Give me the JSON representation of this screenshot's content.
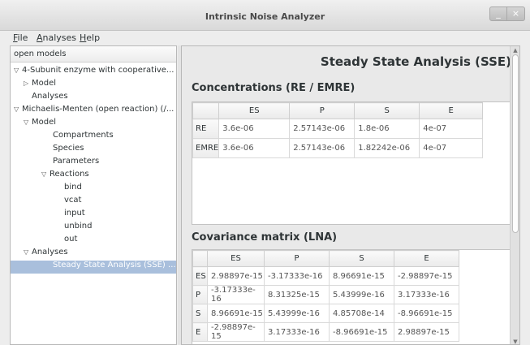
{
  "window": {
    "title": "Intrinsic Noise Analyzer",
    "minimize_glyph": "_",
    "close_glyph": "×"
  },
  "menu": [
    {
      "mnemonic": "F",
      "rest": "ile"
    },
    {
      "mnemonic": "A",
      "rest": "nalyses"
    },
    {
      "mnemonic": "H",
      "rest": "elp"
    }
  ],
  "sidebar": {
    "header": "open models",
    "items": [
      {
        "label": "4-Subunit enzyme with cooperative...",
        "arrow": "▽"
      },
      {
        "label": "Model",
        "arrow": "▷"
      },
      {
        "label": "Analyses",
        "arrow": ""
      },
      {
        "label": "Michaelis-Menten (open reaction) (/...",
        "arrow": "▽"
      },
      {
        "label": "Model",
        "arrow": "▽"
      },
      {
        "label": "Compartments",
        "arrow": ""
      },
      {
        "label": "Species",
        "arrow": ""
      },
      {
        "label": "Parameters",
        "arrow": ""
      },
      {
        "label": "Reactions",
        "arrow": "▽"
      },
      {
        "label": "bind",
        "arrow": ""
      },
      {
        "label": "vcat",
        "arrow": ""
      },
      {
        "label": "input",
        "arrow": ""
      },
      {
        "label": "unbind",
        "arrow": ""
      },
      {
        "label": "out",
        "arrow": ""
      },
      {
        "label": "Analyses",
        "arrow": "▽"
      },
      {
        "label": "Steady State Analysis (SSE) ...",
        "arrow": ""
      }
    ]
  },
  "main": {
    "title": "Steady State Analysis (SSE)",
    "concentrations": {
      "title": "Concentrations (RE / EMRE)",
      "columns": [
        "ES",
        "P",
        "S",
        "E"
      ],
      "rows": [
        {
          "label": "RE",
          "values": [
            "3.6e-06",
            "2.57143e-06",
            "1.8e-06",
            "4e-07"
          ]
        },
        {
          "label": "EMRE",
          "values": [
            "3.6e-06",
            "2.57143e-06",
            "1.82242e-06",
            "4e-07"
          ]
        }
      ]
    },
    "covariance": {
      "title": "Covariance matrix (LNA)",
      "columns": [
        "ES",
        "P",
        "S",
        "E"
      ],
      "rows": [
        {
          "label": "ES",
          "values": [
            "2.98897e-15",
            "-3.17333e-16",
            "8.96691e-15",
            "-2.98897e-15"
          ]
        },
        {
          "label": "P",
          "values": [
            "-3.17333e-16",
            "8.31325e-15",
            "5.43999e-16",
            "3.17333e-16"
          ]
        },
        {
          "label": "S",
          "values": [
            "8.96691e-15",
            "5.43999e-16",
            "4.85708e-14",
            "-8.96691e-15"
          ]
        },
        {
          "label": "E",
          "values": [
            "-2.98897e-15",
            "3.17333e-16",
            "-8.96691e-15",
            "2.98897e-15"
          ]
        }
      ]
    }
  }
}
